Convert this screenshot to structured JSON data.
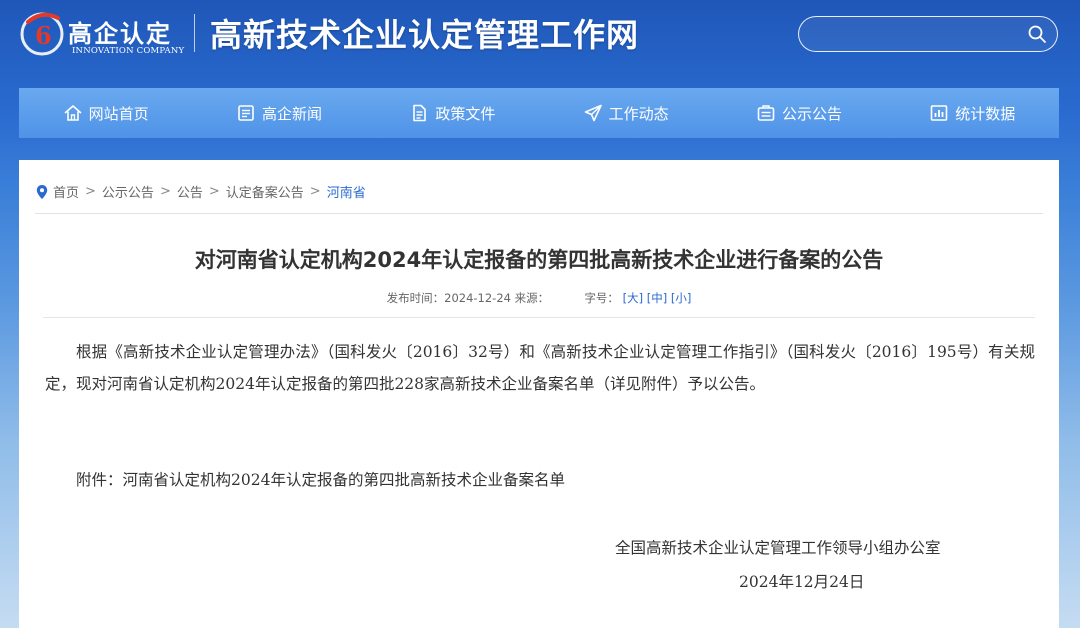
{
  "header": {
    "logo_cn": "高企认定",
    "logo_en": "INNOVATION COMPANY",
    "site_title": "高新技术企业认定管理工作网",
    "search_placeholder": ""
  },
  "nav": {
    "items": [
      {
        "label": "网站首页",
        "icon": "home-icon"
      },
      {
        "label": "高企新闻",
        "icon": "news-icon"
      },
      {
        "label": "政策文件",
        "icon": "document-icon"
      },
      {
        "label": "工作动态",
        "icon": "paper-plane-icon"
      },
      {
        "label": "公示公告",
        "icon": "notice-icon"
      },
      {
        "label": "统计数据",
        "icon": "chart-icon"
      }
    ]
  },
  "breadcrumb": {
    "items": [
      "首页",
      "公示公告",
      "公告",
      "认定备案公告",
      "河南省"
    ],
    "separator": ">"
  },
  "article": {
    "title": "对河南省认定机构2024年认定报备的第四批高新技术企业进行备案的公告",
    "meta": {
      "publish_label": "发布时间：2024-12-24 来源：",
      "font_label": "字号：",
      "font_large": "[大]",
      "font_medium": "[中]",
      "font_small": "[小]"
    },
    "body": "根据《高新技术企业认定管理办法》（国科发火〔2016〕32号）和《高新技术企业认定管理工作指引》（国科发火〔2016〕195号）有关规定，现对河南省认定机构2024年认定报备的第四批228家高新技术企业备案名单（详见附件）予以公告。",
    "attachment": "附件：河南省认定机构2024年认定报备的第四批高新技术企业备案名单",
    "signature_org": "全国高新技术企业认定管理工作领导小组办公室",
    "signature_date": "2024年12月24日"
  },
  "colors": {
    "nav_bg": "#5a9bec",
    "link": "#2b6bd0",
    "logo_red": "#e23a2a"
  }
}
